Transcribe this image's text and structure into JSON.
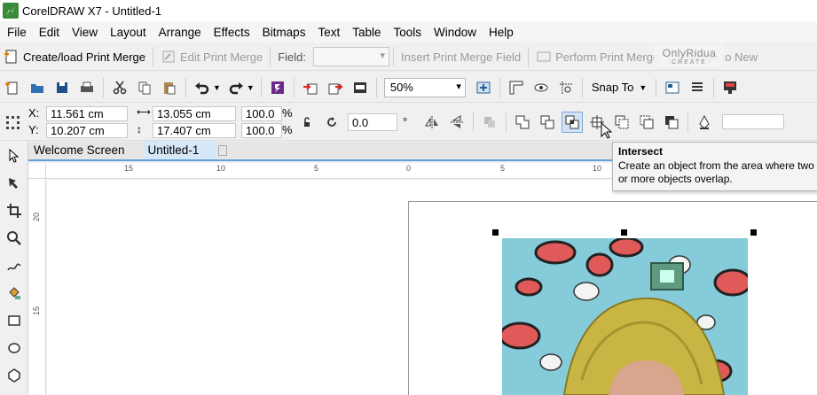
{
  "window": {
    "title": "CorelDRAW X7 - Untitled-1"
  },
  "menu": [
    "File",
    "Edit",
    "View",
    "Layout",
    "Arrange",
    "Effects",
    "Bitmaps",
    "Text",
    "Table",
    "Tools",
    "Window",
    "Help"
  ],
  "print_merge": {
    "create_label": "Create/load Print Merge",
    "edit_label": "Edit Print Merge",
    "field_label": "Field:",
    "insert_label": "Insert Print Merge Field",
    "perform_label": "Perform Print Merge",
    "merge_new_label": "Merge to New"
  },
  "watermark": {
    "line1": "OnlyRidua",
    "line2": "CREATE"
  },
  "standard": {
    "zoom_value": "50%",
    "snap_label": "Snap To"
  },
  "property_bar": {
    "x_label": "X:",
    "x_value": "11.561 cm",
    "y_label": "Y:",
    "y_value": "10.207 cm",
    "w_value": "13.055 cm",
    "h_value": "17.407 cm",
    "scale_w": "100.0",
    "scale_h": "100.0",
    "pct": "%",
    "rotation": "0.0",
    "degree": "°"
  },
  "tabs": [
    "Welcome Screen",
    "Untitled-1"
  ],
  "hruler_labels": [
    "15",
    "10",
    "5",
    "0",
    "5",
    "10"
  ],
  "vruler_labels": [
    "20",
    "15"
  ],
  "tooltip": {
    "title": "Intersect",
    "description": "Create an object from the area where two or more objects overlap."
  },
  "colors": {
    "accent": "#5fa0d8",
    "hover": "#cfe3f5"
  }
}
